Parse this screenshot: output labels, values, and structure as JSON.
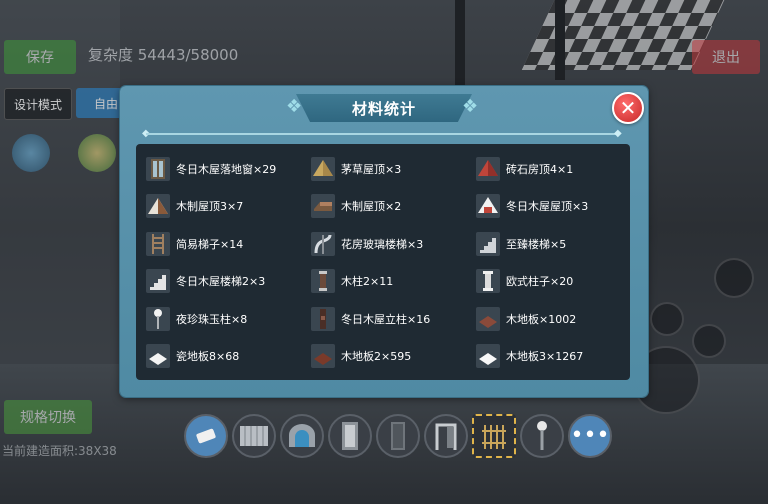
{
  "hud": {
    "save_label": "保存",
    "complexity_text": "复杂度 54443/58000",
    "exit_label": "退出",
    "design_mode_label": "设计模式",
    "free_mode_label": "自由",
    "spec_switch_label": "规格切换",
    "current_area_text": "当前建造面积:38X38"
  },
  "dialog": {
    "title": "材料统计",
    "close_symbol": "✕",
    "items": [
      {
        "label": "冬日木屋落地窗×29",
        "icon": "window-icon"
      },
      {
        "label": "茅草屋顶×3",
        "icon": "thatch-roof-icon"
      },
      {
        "label": "砖石房顶4×1",
        "icon": "brick-roof-icon"
      },
      {
        "label": "木制屋顶3×7",
        "icon": "wood-roof-icon"
      },
      {
        "label": "木制屋顶×2",
        "icon": "wood-roof-flat-icon"
      },
      {
        "label": "冬日木屋屋顶×3",
        "icon": "winter-roof-icon"
      },
      {
        "label": "简易梯子×14",
        "icon": "ladder-icon"
      },
      {
        "label": "花房玻璃楼梯×3",
        "icon": "spiral-stair-icon"
      },
      {
        "label": "至臻楼梯×5",
        "icon": "stair-icon"
      },
      {
        "label": "冬日木屋楼梯2×3",
        "icon": "stair-icon"
      },
      {
        "label": "木柱2×11",
        "icon": "wood-pillar-icon"
      },
      {
        "label": "欧式柱子×20",
        "icon": "euro-column-icon"
      },
      {
        "label": "夜珍珠玉柱×8",
        "icon": "lamp-pillar-icon"
      },
      {
        "label": "冬日木屋立柱×16",
        "icon": "dark-pillar-icon"
      },
      {
        "label": "木地板×1002",
        "icon": "wood-floor-icon"
      },
      {
        "label": "瓷地板8×68",
        "icon": "tile-floor-icon"
      },
      {
        "label": "木地板2×595",
        "icon": "wood-floor-icon"
      },
      {
        "label": "木地板3×1267",
        "icon": "tile-floor-icon"
      }
    ]
  },
  "toolbar": {
    "more_label": "•••",
    "tools": [
      "eraser-icon",
      "fence-icon",
      "arch-icon",
      "door-icon",
      "wall-icon",
      "frame-icon",
      "gate-icon",
      "lamp-icon"
    ]
  },
  "colors": {
    "dialog_bg": "#5f97b0",
    "panel_bg": "#1f2a33",
    "close_red": "#c62828",
    "accent_green": "#3f9a3a"
  }
}
